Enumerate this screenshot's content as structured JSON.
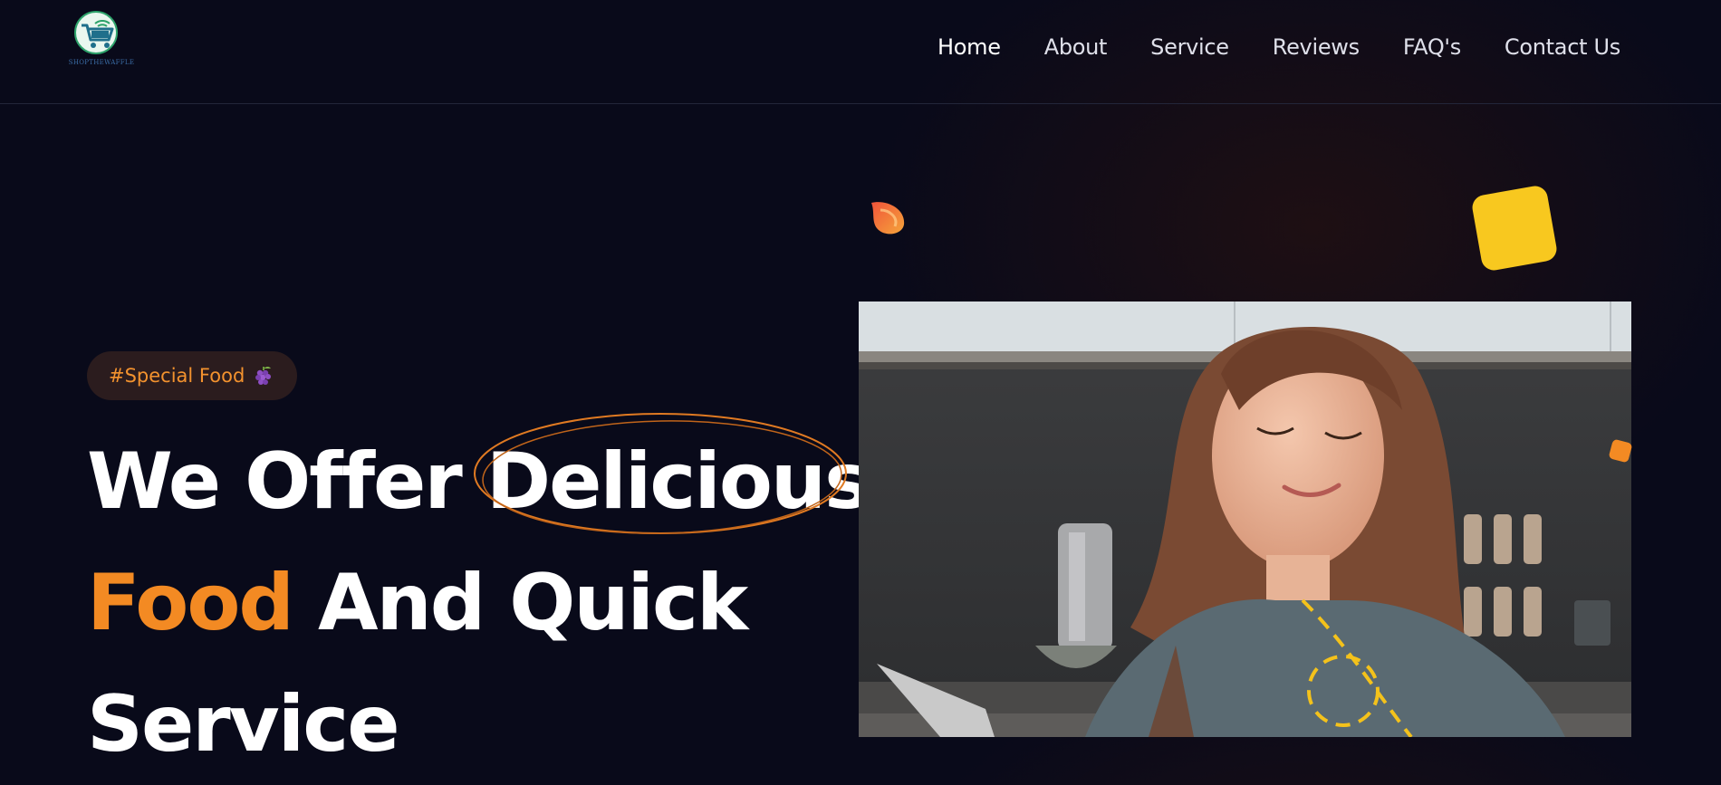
{
  "brand": {
    "logo_text": "SHOPTHEWAFFLE",
    "logo_icon": "shopping-cart-wifi-icon"
  },
  "nav": {
    "items": [
      {
        "label": "Home"
      },
      {
        "label": "About"
      },
      {
        "label": "Service"
      },
      {
        "label": "Reviews"
      },
      {
        "label": "FAQ's"
      },
      {
        "label": "Contact Us"
      }
    ]
  },
  "hero": {
    "badge": "#Special Food",
    "badge_icon": "grapes-icon",
    "headline": {
      "line1_a": "We Offer ",
      "line1_b": "Delicious",
      "line2_a": "Food",
      "line2_b": " And Quick",
      "line3": "Service"
    },
    "image_alt": "Woman smiling with eyes closed in a kitchen"
  },
  "colors": {
    "background": "#090a1a",
    "accent_orange": "#f38a23",
    "accent_yellow": "#f8c81f",
    "badge_bg": "#2b1c1e"
  }
}
